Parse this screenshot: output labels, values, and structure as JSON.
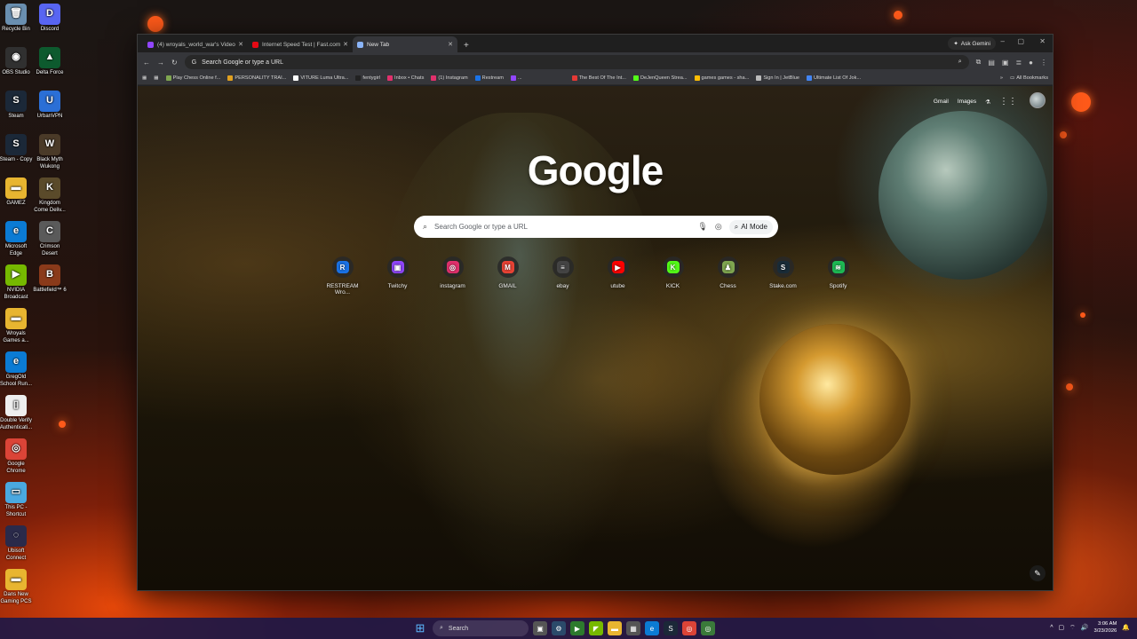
{
  "desktop": {
    "icons": [
      {
        "label": "Recycle Bin",
        "icon": "recycle-bin-icon",
        "color": "#6a8fb0",
        "glyph": "🗑"
      },
      {
        "label": "Discord",
        "icon": "discord-icon",
        "color": "#5865F2",
        "glyph": "D"
      },
      {
        "label": "OBS Studio",
        "icon": "obs-icon",
        "color": "#303030",
        "glyph": "◉"
      },
      {
        "label": "Delta Force",
        "icon": "delta-force-icon",
        "color": "#0d5a2e",
        "glyph": "▲"
      },
      {
        "label": "Steam",
        "icon": "steam-icon",
        "color": "#1b2838",
        "glyph": "S"
      },
      {
        "label": "UrbanVPN",
        "icon": "urbanvpn-icon",
        "color": "#2b6fd6",
        "glyph": "U"
      },
      {
        "label": "Steam - Copy",
        "icon": "steam-copy-icon",
        "color": "#1b2838",
        "glyph": "S"
      },
      {
        "label": "Black Myth Wukong",
        "icon": "black-myth-wukong-icon",
        "color": "#4a3a28",
        "glyph": "W"
      },
      {
        "label": "GAMEZ",
        "icon": "folder-icon",
        "color": "#e8b530",
        "glyph": "▬"
      },
      {
        "label": "Kingdom Come Deliv...",
        "icon": "kingdom-come-icon",
        "color": "#5a4a2a",
        "glyph": "K"
      },
      {
        "label": "Microsoft Edge",
        "icon": "edge-icon",
        "color": "#0b7bd4",
        "glyph": "e"
      },
      {
        "label": "Crimson Desert",
        "icon": "crimson-desert-icon",
        "color": "#5a5a5a",
        "glyph": "C"
      },
      {
        "label": "NVIDIA Broadcast",
        "icon": "nvidia-broadcast-icon",
        "color": "#76b900",
        "glyph": "▶"
      },
      {
        "label": "Battlefield™ 6",
        "icon": "battlefield-icon",
        "color": "#8a3a1a",
        "glyph": "B"
      },
      {
        "label": "Wroyals Games a...",
        "icon": "folder-icon",
        "color": "#e8b530",
        "glyph": "▬"
      },
      {
        "label": "GregOld School Run...",
        "icon": "edge-icon",
        "color": "#0b7bd4",
        "glyph": "e"
      },
      {
        "label": "Double Verify Authenticati...",
        "icon": "document-icon",
        "color": "#eeeeee",
        "glyph": "▯"
      },
      {
        "label": "Google Chrome",
        "icon": "chrome-icon",
        "color": "#db4437",
        "glyph": "◎"
      },
      {
        "label": "This PC - Shortcut",
        "icon": "this-pc-icon",
        "color": "#4aa8e0",
        "glyph": "▭"
      },
      {
        "label": "Ubisoft Connect",
        "icon": "ubisoft-icon",
        "color": "#2a2a4a",
        "glyph": "◌"
      },
      {
        "label": "Dans New Gaming PCS",
        "icon": "folder-icon",
        "color": "#e8b530",
        "glyph": "▬"
      }
    ]
  },
  "browser": {
    "tabs": [
      {
        "title": "(4) wroyals_world_war's Video...",
        "favicon_color": "#9146ff",
        "active": false
      },
      {
        "title": "Internet Speed Test | Fast.com",
        "favicon_color": "#e50914",
        "active": false
      },
      {
        "title": "New Tab",
        "favicon_color": "#8ab4f8",
        "active": true
      }
    ],
    "new_tab_glyph": "+",
    "ask_gemini": "Ask Gemini",
    "omnibox_placeholder": "Search Google or type a URL",
    "bookmarks": [
      {
        "label": "Play Chess Online f...",
        "color": "#7fa650"
      },
      {
        "label": "PERSONALITY TRAI...",
        "color": "#e0a020"
      },
      {
        "label": "VITURE Luma Ultra...",
        "color": "#ffffff"
      },
      {
        "label": "fentygirl",
        "color": "#222222"
      },
      {
        "label": "Inbox • Chats",
        "color": "#e1306c"
      },
      {
        "label": "(1) Instagram",
        "color": "#e1306c"
      },
      {
        "label": "Restream",
        "color": "#1a73e8"
      },
      {
        "label": "...",
        "color": "#9146ff"
      },
      {
        "label": "The Best Of The Int...",
        "color": "#e53935"
      },
      {
        "label": "DeJenQueen Strea...",
        "color": "#53fc18"
      },
      {
        "label": "games games - sha...",
        "color": "#fbbc04"
      },
      {
        "label": "Sign In | JetBlue",
        "color": "#bbbbbb"
      },
      {
        "label": "Ultimate List Of Jok...",
        "color": "#4285f4"
      }
    ],
    "all_bookmarks": "All Bookmarks"
  },
  "ntp": {
    "top_links": {
      "gmail": "Gmail",
      "images": "Images"
    },
    "logo": "Google",
    "search_placeholder": "Search Google or type a URL",
    "ai_mode": "AI Mode",
    "shortcuts": [
      {
        "label": "RESTREAM Wro...",
        "icon": "restream-icon",
        "color": "#1a73e8",
        "glyph": "R"
      },
      {
        "label": "Twitchy",
        "icon": "twitch-icon",
        "color": "#9146ff",
        "glyph": "▣"
      },
      {
        "label": "instagram",
        "icon": "instagram-icon",
        "color": "#e1306c",
        "glyph": "◎"
      },
      {
        "label": "GMAIL",
        "icon": "gmail-icon",
        "color": "#ea4335",
        "glyph": "M"
      },
      {
        "label": "ebay",
        "icon": "ebay-icon",
        "color": "#444444",
        "glyph": "≡"
      },
      {
        "label": "utube",
        "icon": "youtube-icon",
        "color": "#ff0000",
        "glyph": "▶"
      },
      {
        "label": "KICK",
        "icon": "kick-icon",
        "color": "#53fc18",
        "glyph": "K"
      },
      {
        "label": "Chess",
        "icon": "chess-icon",
        "color": "#7fa650",
        "glyph": "♟"
      },
      {
        "label": "Stake.com",
        "icon": "stake-icon",
        "color": "#1a2c38",
        "glyph": "S"
      },
      {
        "label": "Spotify",
        "icon": "spotify-icon",
        "color": "#1db954",
        "glyph": "≋"
      }
    ]
  },
  "taskbar": {
    "search_label": "Search",
    "time": "3:06 AM",
    "date": "3/23/2026"
  }
}
